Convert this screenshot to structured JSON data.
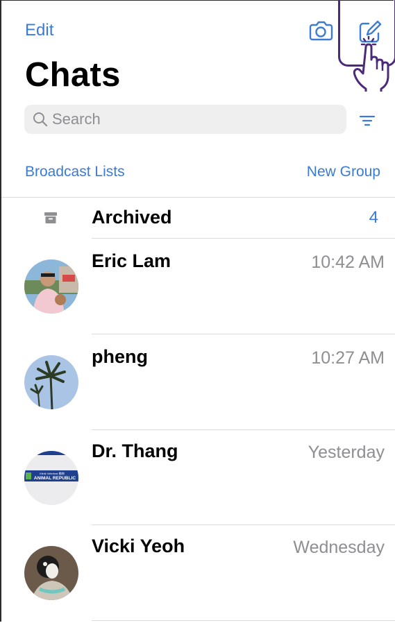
{
  "header": {
    "edit_label": "Edit",
    "title": "Chats",
    "camera_icon": "camera-icon",
    "compose_icon": "compose-icon"
  },
  "search": {
    "placeholder": "Search"
  },
  "links": {
    "broadcast": "Broadcast Lists",
    "new_group": "New Group"
  },
  "archived": {
    "label": "Archived",
    "count": "4"
  },
  "chats": [
    {
      "name": "Eric  Lam",
      "time": "10:42 AM"
    },
    {
      "name": "pheng",
      "time": "10:27 AM"
    },
    {
      "name": "Dr. Thang",
      "time": "Yesterday"
    },
    {
      "name": "Vicki Yeoh",
      "time": "Wednesday"
    }
  ],
  "avatar_badge": {
    "small": "Klinik Veterinar 動物",
    "main": "ANIMAL REPUBLIC"
  },
  "colors": {
    "accent": "#3a7bd5",
    "secondary_text": "#8e8e93",
    "cursor_outline": "#4b2a7b"
  }
}
